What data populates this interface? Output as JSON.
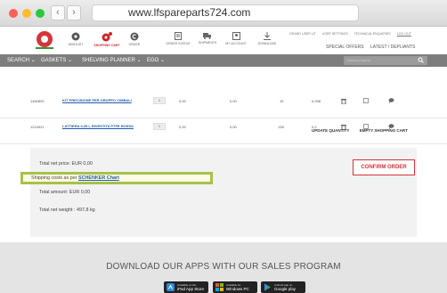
{
  "browser": {
    "url": "www.lfspareparts724.com",
    "back_icon": "chevron-left-icon",
    "forward_icon": "chevron-right-icon"
  },
  "header": {
    "icons": [
      {
        "label": "WISHLIST",
        "icon": "heart-icon"
      },
      {
        "label": "SHOPPING CART",
        "icon": "cart-icon",
        "active": true
      },
      {
        "label": "ORDER",
        "icon": "order-icon"
      },
      {
        "label": "ORDER STATUS",
        "icon": "status-icon"
      },
      {
        "label": "SHIPMENTS",
        "icon": "truck-icon"
      },
      {
        "label": "MY ACCOUNT",
        "icon": "account-icon"
      },
      {
        "label": "DOWNLOAD",
        "icon": "download-icon"
      }
    ],
    "top_links": [
      "GRAND USER UT",
      "USER SETTINGS",
      "TECHNICAL ENQUIRIES",
      "LOG OUT"
    ],
    "special_links": [
      "SPECIAL OFFERS",
      "LATEST / DEPLIANTS"
    ]
  },
  "nav": {
    "menu": [
      "SEARCH ⌄",
      "GASKETS ⌄",
      "SHELVING PLANNER ⌄",
      "EGO ⌄"
    ],
    "search_placeholder": "Ricerca rapida"
  },
  "cart": {
    "rows": [
      {
        "code": "1460800",
        "desc": "KIT PRECISIONE PER GRUPPO CIMBALI",
        "qty": "1",
        "price": "0,00",
        "total": "0,00",
        "weight": "15",
        "volume": "0,098"
      },
      {
        "code": "1224921",
        "desc": "LATTIERA 0,35 L RIVESTITA PTFE ROSSA",
        "qty": "1",
        "price": "0,00",
        "total": "0,00",
        "weight": "138",
        "volume": "0,2"
      }
    ],
    "update_label": "UPDATE QUANTITY",
    "empty_label": "EMPTY SHOPPING CART"
  },
  "totals": {
    "net_price": "Total net price: EUR 0,00",
    "shipping_prefix": "Shipping costs as per ",
    "shipping_link": "SCHENKER Chart",
    "amount": "Total amount: EUR 0,00",
    "weight": "Total net weight : 497,8 kg",
    "confirm_label": "CONFIRM ORDER"
  },
  "footer": {
    "heading": "DOWNLOAD OUR APPS WITH OUR SALES PROGRAM",
    "badges": [
      {
        "small": "Available on the",
        "big": "iPad App Store",
        "icon": "appstore-icon"
      },
      {
        "small": "Available for",
        "big": "Windows PC",
        "icon": "windows-icon"
      },
      {
        "small": "Android app on",
        "big": "Google play",
        "icon": "googleplay-icon"
      }
    ]
  },
  "colors": {
    "accent_red": "#d6333a",
    "highlight_green": "#a6c24a",
    "link_blue": "#1e5ca8",
    "nav_gray": "#7d7d7d"
  }
}
